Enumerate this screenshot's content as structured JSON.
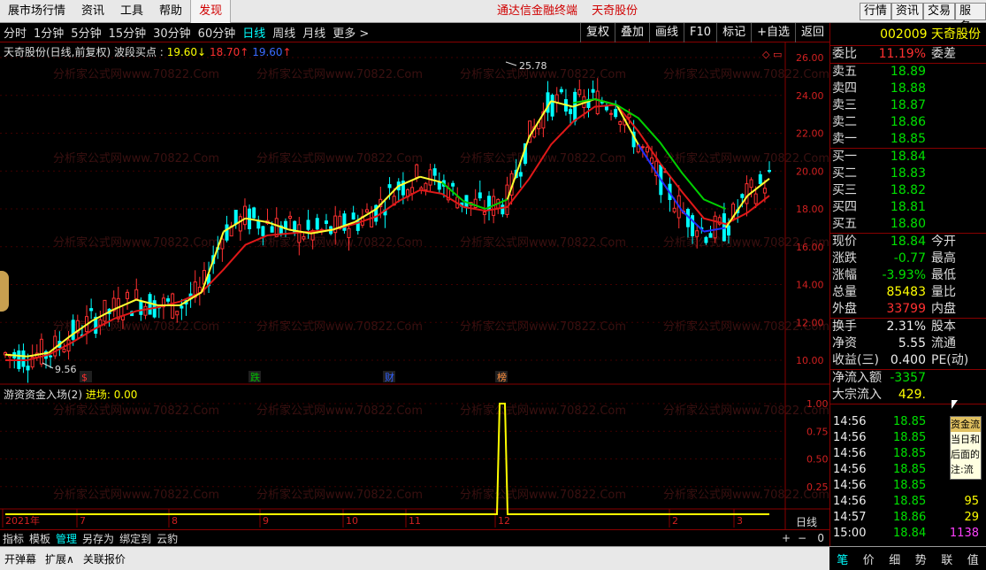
{
  "menu": {
    "items": [
      "展市场行情",
      "资讯",
      "工具",
      "帮助",
      "发现"
    ],
    "center": [
      "通达信金融终端",
      "天奇股份"
    ],
    "right_buttons": [
      "行情",
      "资讯",
      "交易",
      "服务"
    ]
  },
  "periods": [
    "分时",
    "1分钟",
    "5分钟",
    "15分钟",
    "30分钟",
    "60分钟",
    "日线",
    "周线",
    "月线",
    "更多 >"
  ],
  "active_period": "日线",
  "tools": [
    "复权",
    "叠加",
    "画线",
    "F10",
    "标记",
    "+自选",
    "返回"
  ],
  "chart": {
    "title_prefix": "天奇股份(日线,前复权) 波段买点 :",
    "val_yellow": "19.60",
    "val_red": "18.70",
    "val_blue": "19.60",
    "high_label": "25.78",
    "low_label": "9.56",
    "event_markers": [
      "$",
      "跌",
      "财",
      "榜"
    ],
    "x_labels": [
      "2021年",
      "7",
      "8",
      "9",
      "10",
      "11",
      "12",
      "2",
      "3"
    ],
    "period_label": "日线",
    "watermark": "分析家公式网www.70822.Com"
  },
  "indicator": {
    "title": "游资资金入场(2)",
    "field": "进场:",
    "value": "0.00"
  },
  "chart_data": {
    "type": "line",
    "price_axis": [
      26,
      24,
      22,
      20,
      18,
      16,
      14,
      12,
      10
    ],
    "indicator_axis": [
      1,
      0.75,
      0.5,
      0.25
    ],
    "ma_fast_yellow": [
      10.3,
      10.2,
      10.4,
      11.3,
      12.1,
      12.7,
      13.2,
      12.9,
      12.9,
      13.6,
      16.8,
      17.5,
      17.3,
      16.9,
      16.7,
      16.9,
      17.3,
      18.0,
      19.2,
      19.7,
      19.4,
      18.4,
      18.0,
      18.5,
      21.8,
      23.7,
      23.4,
      23.8,
      23.5,
      21.4,
      19.6,
      17.9,
      16.8,
      17.0,
      18.7,
      19.6
    ],
    "ma_slow_red": [
      10.0,
      10.0,
      10.3,
      10.9,
      11.6,
      12.2,
      12.6,
      12.8,
      13.1,
      13.6,
      14.8,
      16.1,
      16.6,
      16.7,
      16.8,
      16.9,
      17.2,
      17.6,
      18.4,
      19.0,
      18.8,
      18.1,
      17.9,
      18.1,
      19.6,
      21.4,
      22.6,
      23.4,
      23.5,
      22.1,
      20.4,
      18.9,
      17.5,
      17.2,
      17.8,
      18.7
    ]
  },
  "quote": {
    "code": "002009",
    "name": "天奇股份",
    "weibi_label": "委比",
    "weibi": "11.19%",
    "weicha_label": "委差",
    "sells": [
      {
        "label": "卖五",
        "price": "18.89"
      },
      {
        "label": "卖四",
        "price": "18.88"
      },
      {
        "label": "卖三",
        "price": "18.87"
      },
      {
        "label": "卖二",
        "price": "18.86"
      },
      {
        "label": "卖一",
        "price": "18.85"
      }
    ],
    "buys": [
      {
        "label": "买一",
        "price": "18.84"
      },
      {
        "label": "买二",
        "price": "18.83"
      },
      {
        "label": "买三",
        "price": "18.82"
      },
      {
        "label": "买四",
        "price": "18.81"
      },
      {
        "label": "买五",
        "price": "18.80"
      }
    ],
    "stats": [
      {
        "l": "现价",
        "v": "18.84",
        "r": "今开",
        "c": "g"
      },
      {
        "l": "涨跌",
        "v": "-0.77",
        "r": "最高",
        "c": "g"
      },
      {
        "l": "涨幅",
        "v": "-3.93%",
        "r": "最低",
        "c": "g"
      },
      {
        "l": "总量",
        "v": "85483",
        "r": "量比",
        "c": "yy"
      },
      {
        "l": "外盘",
        "v": "33799",
        "r": "内盘",
        "c": "r"
      }
    ],
    "stats2": [
      {
        "l": "换手",
        "v": "2.31%",
        "r": "股本"
      },
      {
        "l": "净资",
        "v": "5.55",
        "r": "流通"
      },
      {
        "l": "收益(三)",
        "v": "0.400",
        "r": "PE(动)"
      }
    ],
    "flow": [
      {
        "l": "净流入额",
        "v": "-3357"
      },
      {
        "l": "大宗流入",
        "v": "429."
      }
    ],
    "ticks": [
      {
        "t": "14:56",
        "p": "18.85",
        "v": ""
      },
      {
        "t": "14:56",
        "p": "18.85",
        "v": ""
      },
      {
        "t": "14:56",
        "p": "18.85",
        "v": ""
      },
      {
        "t": "14:56",
        "p": "18.85",
        "v": ""
      },
      {
        "t": "14:56",
        "p": "18.85",
        "v": ""
      },
      {
        "t": "14:56",
        "p": "18.85",
        "v": "95"
      },
      {
        "t": "14:57",
        "p": "18.86",
        "v": "29"
      },
      {
        "t": "15:00",
        "p": "18.84",
        "v": "1138"
      }
    ],
    "tooltip": [
      "资金流",
      "当日和",
      "后面的",
      "注:流入"
    ]
  },
  "bottom_tabs": [
    "指标",
    "模板",
    "管理",
    "另存为",
    "绑定到",
    "云豹"
  ],
  "bottom_tabs_active": "管理",
  "zoom_controls": [
    "+",
    "−",
    "0"
  ],
  "status": [
    "开弹幕",
    "扩展∧",
    "关联报价"
  ],
  "side_tabs": [
    "笔",
    "价",
    "细",
    "势",
    "联",
    "值"
  ],
  "side_tabs_active": "笔"
}
